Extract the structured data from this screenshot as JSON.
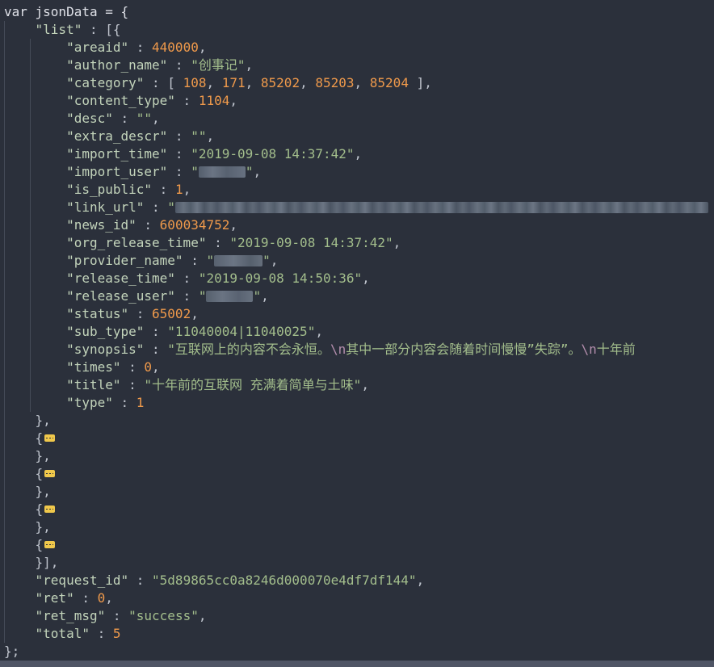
{
  "code": {
    "var_decl": "var jsonData = {",
    "list_key": "\"list\"",
    "item": {
      "areaid": {
        "key": "\"areaid\"",
        "value": "440000"
      },
      "author_name": {
        "key": "\"author_name\"",
        "value": "\"创事记\""
      },
      "category": {
        "key": "\"category\"",
        "values": [
          "108",
          "171",
          "85202",
          "85203",
          "85204"
        ]
      },
      "content_type": {
        "key": "\"content_type\"",
        "value": "1104"
      },
      "desc": {
        "key": "\"desc\"",
        "value": "\"\""
      },
      "extra_descr": {
        "key": "\"extra_descr\"",
        "value": "\"\""
      },
      "import_time": {
        "key": "\"import_time\"",
        "value": "\"2019-09-08 14:37:42\""
      },
      "import_user": {
        "key": "\"import_user\""
      },
      "is_public": {
        "key": "\"is_public\"",
        "value": "1"
      },
      "link_url": {
        "key": "\"link_url\"",
        "value": "\""
      },
      "news_id": {
        "key": "\"news_id\"",
        "value": "600034752"
      },
      "org_release_time": {
        "key": "\"org_release_time\"",
        "value": "\"2019-09-08 14:37:42\""
      },
      "provider_name": {
        "key": "\"provider_name\""
      },
      "release_time": {
        "key": "\"release_time\"",
        "value": "\"2019-09-08 14:50:36\""
      },
      "release_user": {
        "key": "\"release_user\""
      },
      "status": {
        "key": "\"status\"",
        "value": "65002"
      },
      "sub_type": {
        "key": "\"sub_type\"",
        "value": "\"11040004|11040025\""
      },
      "synopsis": {
        "key": "\"synopsis\"",
        "part1": "\"互联网上的内容不会永恒。",
        "esc1": "\\n",
        "part2": "其中一部分内容会随着时间慢慢”失踪”。",
        "esc2": "\\n",
        "part3": "十年前"
      },
      "times": {
        "key": "\"times\"",
        "value": "0"
      },
      "title": {
        "key": "\"title\"",
        "value": "\"十年前的互联网 充满着简单与土味\""
      },
      "type": {
        "key": "\"type\"",
        "value": "1"
      }
    },
    "request_id": {
      "key": "\"request_id\"",
      "value": "\"5d89865cc0a8246d000070e4df7df144\""
    },
    "ret": {
      "key": "\"ret\"",
      "value": "0"
    },
    "ret_msg": {
      "key": "\"ret_msg\"",
      "value": "\"success\""
    },
    "total": {
      "key": "\"total\"",
      "value": "5"
    },
    "closing": "};"
  },
  "colors": {
    "background": "#2b303b",
    "key": "#c3d4bb",
    "string": "#a3be8c",
    "number": "#f09a4b",
    "escape": "#b48ead",
    "fold_marker": "#f0c84b"
  },
  "icons": [
    "fold-ellipsis-icon"
  ]
}
